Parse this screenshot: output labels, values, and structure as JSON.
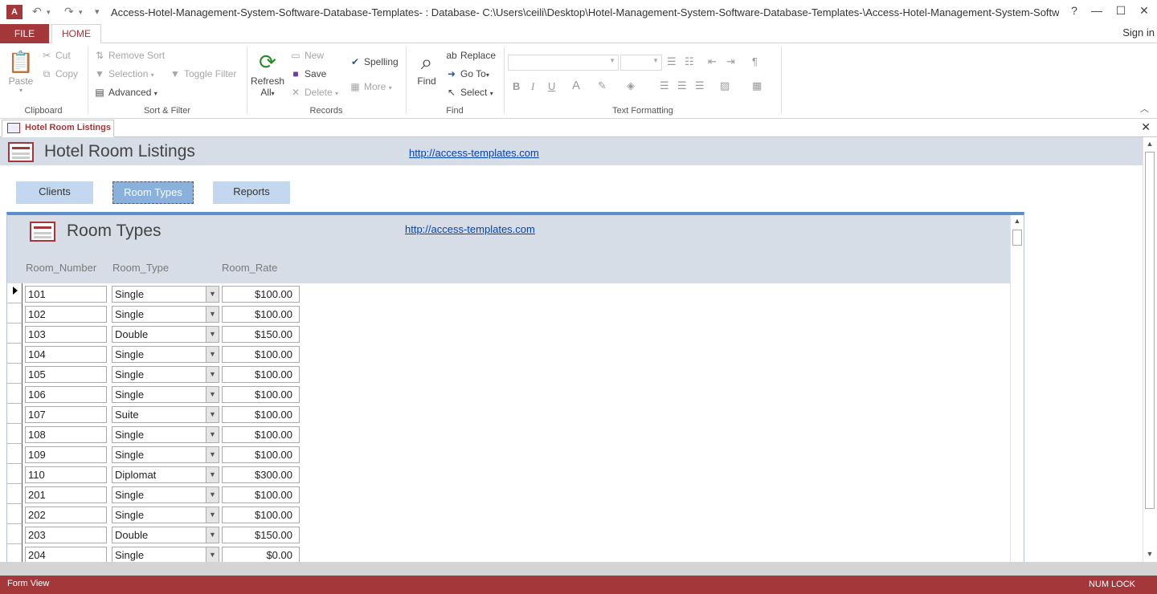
{
  "window": {
    "title": "Access-Hotel-Management-System-Software-Database-Templates- : Database- C:\\Users\\ceili\\Desktop\\Hotel-Management-System-Software-Database-Templates-\\Access-Hotel-Management-System-Software-Database-...",
    "help": "?",
    "minimize": "—",
    "maximize": "☐",
    "close": "✕"
  },
  "qat": {
    "undo": "↶",
    "redo": "↷",
    "customize": "▾"
  },
  "tabs": {
    "file": "FILE",
    "home": "HOME",
    "signin": "Sign in"
  },
  "ribbon": {
    "clipboard": {
      "label": "Clipboard",
      "paste": "Paste",
      "cut": "Cut",
      "copy": "Copy"
    },
    "sort_filter": {
      "label": "Sort & Filter",
      "remove_sort": "Remove Sort",
      "selection": "Selection",
      "advanced": "Advanced",
      "toggle_filter": "Toggle Filter"
    },
    "records": {
      "label": "Records",
      "refresh": "Refresh",
      "refresh_all": "All",
      "new": "New",
      "save": "Save",
      "delete": "Delete",
      "spelling": "Spelling",
      "more": "More"
    },
    "find": {
      "label": "Find",
      "find": "Find",
      "replace": "Replace",
      "goto": "Go To",
      "select": "Select"
    },
    "text_formatting": {
      "label": "Text Formatting",
      "bold": "B",
      "italic": "I",
      "underline": "U",
      "fontcolor": "A"
    }
  },
  "document_tab": {
    "label": "Hotel Room Listings",
    "close": "✕"
  },
  "form": {
    "title": "Hotel Room Listings",
    "link": "http://access-templates.com",
    "nav": [
      "Clients",
      "Room Types",
      "Reports"
    ],
    "nav_selected": 1
  },
  "subform": {
    "title": "Room Types",
    "link": "http://access-templates.com",
    "columns": [
      "Room_Number",
      "Room_Type",
      "Room_Rate"
    ],
    "rows": [
      [
        "101",
        "Single",
        "$100.00"
      ],
      [
        "102",
        "Single",
        "$100.00"
      ],
      [
        "103",
        "Double",
        "$150.00"
      ],
      [
        "104",
        "Single",
        "$100.00"
      ],
      [
        "105",
        "Single",
        "$100.00"
      ],
      [
        "106",
        "Single",
        "$100.00"
      ],
      [
        "107",
        "Suite",
        "$100.00"
      ],
      [
        "108",
        "Single",
        "$100.00"
      ],
      [
        "109",
        "Single",
        "$100.00"
      ],
      [
        "110",
        "Diplomat",
        "$300.00"
      ],
      [
        "201",
        "Single",
        "$100.00"
      ],
      [
        "202",
        "Single",
        "$100.00"
      ],
      [
        "203",
        "Double",
        "$150.00"
      ],
      [
        "204",
        "Single",
        "$0.00"
      ]
    ]
  },
  "status": {
    "view": "Form View",
    "numlock": "NUM LOCK"
  },
  "colors": {
    "accent": "#a4373a",
    "header_bg": "#d6dde6",
    "nav_bg": "#c3d8ef",
    "link": "#0645ad"
  }
}
